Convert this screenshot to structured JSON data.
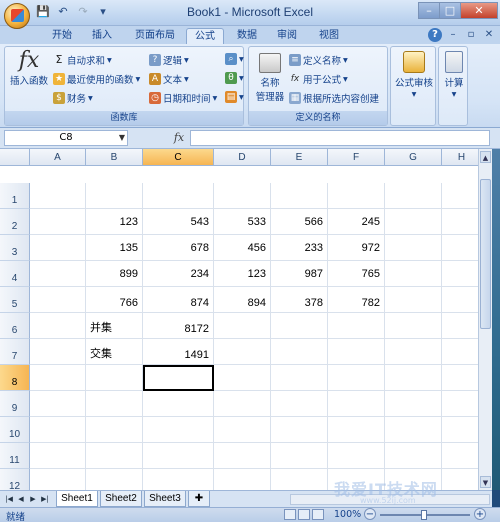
{
  "window": {
    "title": "Book1 - Microsoft Excel",
    "controls": [
      "–",
      "□",
      "✕"
    ]
  },
  "quick_access": [
    "save-icon",
    "undo-icon",
    "redo-icon",
    "customize-icon"
  ],
  "ribbon_tabs": [
    "开始",
    "插入",
    "页面布局",
    "公式",
    "数据",
    "审阅",
    "视图"
  ],
  "active_tab": "公式",
  "ribbon": {
    "function_library": {
      "label": "函数库",
      "insert_function": "插入函数",
      "autosum": "自动求和",
      "recent": "最近使用的函数",
      "financial": "财务",
      "logical": "逻辑",
      "text": "文本",
      "datetime": "日期和时间"
    },
    "defined_names": {
      "label": "定义的名称",
      "name_manager_line1": "名称",
      "name_manager_line2": "管理器",
      "define_name": "定义名称",
      "use_in_formula": "用于公式",
      "create_from_selection": "根据所选内容创建"
    },
    "auditing": {
      "label": "公式审核"
    },
    "calculation": {
      "label": "计算"
    }
  },
  "formula_bar": {
    "name_box": "C8",
    "fx_label": "fx",
    "formula": ""
  },
  "grid": {
    "columns": [
      "A",
      "B",
      "C",
      "D",
      "E",
      "F",
      "G",
      "H"
    ],
    "selected_column": "C",
    "rows": [
      "1",
      "2",
      "3",
      "4",
      "5",
      "6",
      "7",
      "8",
      "9",
      "10",
      "11",
      "12"
    ],
    "selected_row": "8",
    "data": [
      [
        "",
        "",
        "",
        "",
        "",
        "",
        "",
        ""
      ],
      [
        "",
        "123",
        "543",
        "533",
        "566",
        "245",
        "",
        ""
      ],
      [
        "",
        "135",
        "678",
        "456",
        "233",
        "972",
        "",
        ""
      ],
      [
        "",
        "899",
        "234",
        "123",
        "987",
        "765",
        "",
        ""
      ],
      [
        "",
        "766",
        "874",
        "894",
        "378",
        "782",
        "",
        ""
      ],
      [
        "",
        "并集",
        "8172",
        "",
        "",
        "",
        "",
        ""
      ],
      [
        "",
        "交集",
        "1491",
        "",
        "",
        "",
        "",
        ""
      ],
      [
        "",
        "",
        "",
        "",
        "",
        "",
        "",
        ""
      ],
      [
        "",
        "",
        "",
        "",
        "",
        "",
        "",
        ""
      ],
      [
        "",
        "",
        "",
        "",
        "",
        "",
        "",
        ""
      ],
      [
        "",
        "",
        "",
        "",
        "",
        "",
        "",
        ""
      ],
      [
        "",
        "",
        "",
        "",
        "",
        "",
        "",
        ""
      ]
    ]
  },
  "sheet_tabs": [
    "Sheet1",
    "Sheet2",
    "Sheet3"
  ],
  "active_sheet": "Sheet1",
  "status": {
    "ready": "就绪",
    "zoom": "100%"
  },
  "watermark": {
    "text": "我爱IT技术网",
    "url": "www.52ij.com"
  }
}
